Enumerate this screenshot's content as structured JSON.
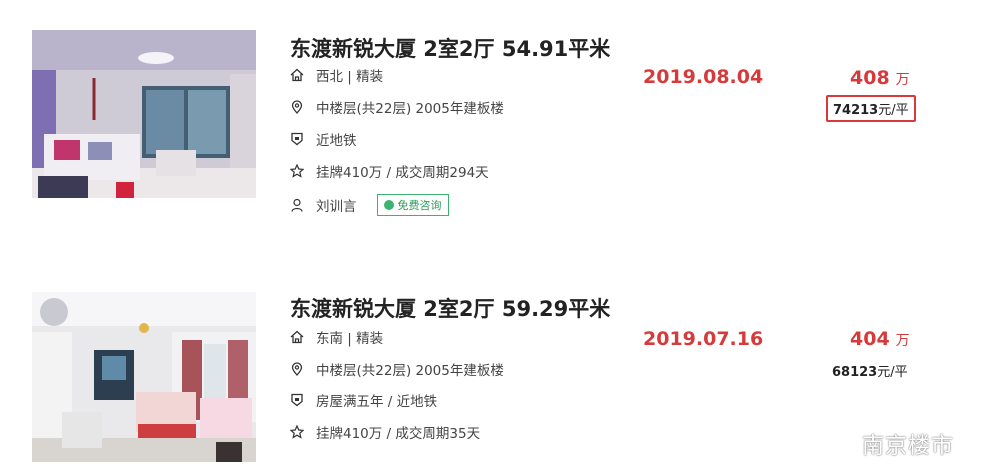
{
  "listings": [
    {
      "title": "东渡新锐大厦 2室2厅 54.91平米",
      "orientation_decoration": "西北 | 精装",
      "floor_info": "中楼层(共22层) 2005年建板楼",
      "tags": "近地铁",
      "listing_info": "挂牌410万 / 成交周期294天",
      "agent": "刘训言",
      "consult_label": "免费咨询",
      "deal_date": "2019.08.04",
      "total_price": "408",
      "total_price_unit": "万",
      "unit_price_value": "74213",
      "unit_price_suffix": "元/平"
    },
    {
      "title": "东渡新锐大厦 2室2厅 59.29平米",
      "orientation_decoration": "东南 | 精装",
      "floor_info": "中楼层(共22层) 2005年建板楼",
      "tags": "房屋满五年 / 近地铁",
      "listing_info": "挂牌410万 / 成交周期35天",
      "deal_date": "2019.07.16",
      "total_price": "404",
      "total_price_unit": "万",
      "unit_price_value": "68123",
      "unit_price_suffix": "元/平"
    }
  ],
  "watermark": {
    "text": "南京楼市"
  },
  "colors": {
    "accent_red": "#d63a3a",
    "consult_green": "#3cb371"
  },
  "icons": [
    "home-icon",
    "location-icon",
    "tag-icon",
    "star-icon",
    "user-icon",
    "chat-icon"
  ]
}
